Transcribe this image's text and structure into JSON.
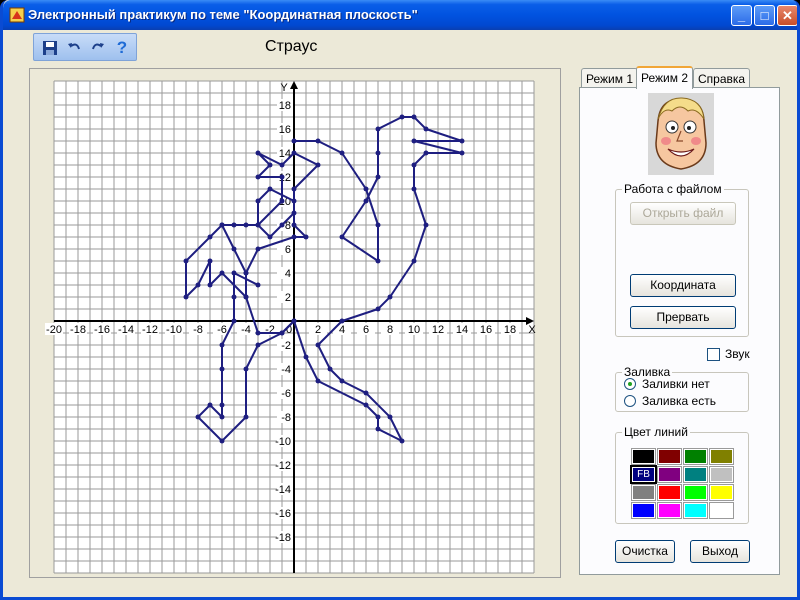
{
  "window": {
    "title": "Электронный практикум по теме \"Координатная плоскость\"",
    "minimize": "_",
    "maximize": "□",
    "close": "✕"
  },
  "toolbar": {
    "tools": [
      "save-icon",
      "undo-icon",
      "redo-icon",
      "help-icon"
    ],
    "help_glyph": "?"
  },
  "figure": {
    "title": "Страус"
  },
  "plot": {
    "x_label": "X",
    "y_label": "Y",
    "xlim": [
      -20,
      20
    ],
    "ylim": [
      -20,
      20
    ],
    "x_ticks": [
      -20,
      -18,
      -16,
      -14,
      -12,
      -10,
      -8,
      -6,
      -4,
      -2,
      2,
      4,
      6,
      8,
      10,
      12,
      14,
      16,
      18
    ],
    "y_ticks": [
      18,
      16,
      14,
      12,
      10,
      8,
      6,
      4,
      2,
      -2,
      -4,
      -6,
      -8,
      -10,
      -12,
      -14,
      -16,
      -18
    ],
    "origin_label": "0",
    "grid": true,
    "line_color": "#1e1e80"
  },
  "chart_data": {
    "type": "line",
    "title": "Страус",
    "xlabel": "X",
    "ylabel": "Y",
    "xlim": [
      -20,
      20
    ],
    "ylim": [
      -20,
      20
    ],
    "series": [
      {
        "points": [
          [
            0,
            15
          ],
          [
            2,
            15
          ],
          [
            4,
            14
          ],
          [
            6,
            11
          ],
          [
            7,
            8
          ],
          [
            7,
            5
          ],
          [
            4,
            7
          ],
          [
            6,
            10
          ],
          [
            7,
            12
          ],
          [
            7,
            14
          ],
          [
            7,
            16
          ],
          [
            9,
            17
          ],
          [
            10,
            17
          ],
          [
            11,
            16
          ],
          [
            14,
            15
          ],
          [
            10,
            15
          ],
          [
            14,
            14
          ],
          [
            11,
            14
          ],
          [
            10,
            13
          ],
          [
            10,
            11
          ],
          [
            11,
            8
          ],
          [
            10,
            5
          ],
          [
            8,
            2
          ],
          [
            7,
            1
          ],
          [
            4,
            0
          ],
          [
            2,
            -2
          ],
          [
            3,
            -4
          ],
          [
            4,
            -5
          ],
          [
            6,
            -6
          ],
          [
            8,
            -8
          ],
          [
            9,
            -10
          ],
          [
            7,
            -9
          ],
          [
            7,
            -8
          ],
          [
            6,
            -7
          ],
          [
            2,
            -5
          ],
          [
            1,
            -3
          ],
          [
            0,
            0
          ],
          [
            -1,
            -1
          ],
          [
            -3,
            -1
          ],
          [
            -4,
            2
          ],
          [
            -4,
            4
          ],
          [
            -5,
            6
          ],
          [
            -6,
            8
          ],
          [
            -5,
            8
          ],
          [
            -4,
            8
          ],
          [
            -3,
            8
          ],
          [
            -2,
            7
          ],
          [
            -1,
            8
          ],
          [
            0,
            9
          ],
          [
            0,
            10
          ],
          [
            -2,
            11
          ],
          [
            -3,
            10
          ],
          [
            -3,
            8
          ],
          [
            -1,
            10
          ],
          [
            -1,
            12
          ],
          [
            -3,
            12
          ],
          [
            -2,
            13
          ],
          [
            -3,
            14
          ],
          [
            -1,
            13
          ],
          [
            0,
            14
          ],
          [
            2,
            13
          ],
          [
            0,
            11
          ],
          [
            0,
            8
          ],
          [
            1,
            7
          ],
          [
            0,
            7
          ],
          [
            -3,
            6
          ],
          [
            -4,
            4
          ],
          [
            -4,
            2
          ],
          [
            -6,
            4
          ],
          [
            -7,
            3
          ],
          [
            -7,
            5
          ],
          [
            -8,
            3
          ],
          [
            -9,
            2
          ],
          [
            -9,
            5
          ],
          [
            -7,
            7
          ],
          [
            -6,
            8
          ]
        ]
      },
      {
        "points": [
          [
            -3,
            3
          ],
          [
            -5,
            4
          ],
          [
            -5,
            2
          ],
          [
            -5,
            0
          ],
          [
            -6,
            -2
          ],
          [
            -6,
            -4
          ],
          [
            -6,
            -7
          ],
          [
            -6,
            -8
          ],
          [
            -7,
            -7
          ],
          [
            -8,
            -8
          ],
          [
            -6,
            -10
          ],
          [
            -4,
            -8
          ],
          [
            -4,
            -4
          ],
          [
            -3,
            -2
          ],
          [
            -1,
            -1
          ],
          [
            0,
            0
          ]
        ]
      }
    ]
  },
  "tabs": [
    {
      "label": "Режим 1",
      "active": false
    },
    {
      "label": "Режим 2",
      "active": true
    },
    {
      "label": "Справка",
      "active": false
    }
  ],
  "file_group": {
    "title": "Работа с файлом",
    "open_label": "Открыть файл",
    "coords_label": "Координата",
    "stop_label": "Прервать"
  },
  "sound": {
    "label": "Звук",
    "checked": false
  },
  "fill_group": {
    "title": "Заливка",
    "options": [
      {
        "label": "Заливки нет",
        "selected": true
      },
      {
        "label": "Заливка есть",
        "selected": false
      }
    ]
  },
  "color_group": {
    "title": "Цвет линий",
    "colors": [
      "#000000",
      "#800000",
      "#008000",
      "#808000",
      "#000080",
      "#800080",
      "#008080",
      "#c0c0c0",
      "#808080",
      "#ff0000",
      "#00ff00",
      "#ffff00",
      "#0000ff",
      "#ff00ff",
      "#00ffff",
      "#ffffff"
    ],
    "selected_index": 4,
    "selected_code": "FB"
  },
  "footer": {
    "clear_label": "Очистка",
    "exit_label": "Выход"
  }
}
